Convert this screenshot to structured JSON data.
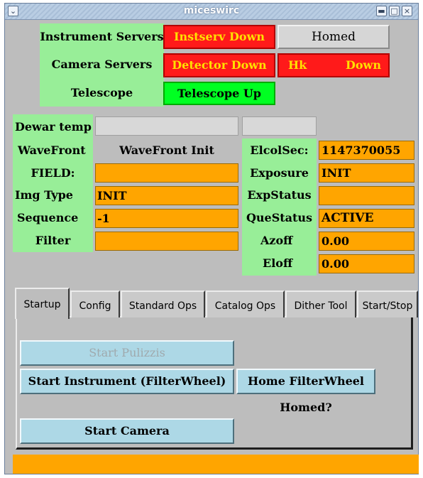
{
  "window": {
    "title": "miceswirc"
  },
  "servers": {
    "instrument_label": "Instrument Servers",
    "instrument_status": "Instserv Down",
    "homed_status": "Homed",
    "camera_label": "Camera Servers",
    "detector_status": "Detector Down",
    "hk_label": "Hk",
    "hk_status": "Down",
    "telescope_label": "Telescope",
    "telescope_status": "Telescope Up"
  },
  "status_left": {
    "dewar_label": "Dewar temp",
    "dewar_value": "",
    "dewar_value2": "",
    "wavefront_label": "WaveFront",
    "wavefront_value": "WaveFront Init",
    "field_label": "FIELD:",
    "field_value": "",
    "imgtype_label": "Img Type",
    "imgtype_value": "INIT",
    "sequence_label": "Sequence",
    "sequence_value": "-1",
    "filter_label": "Filter",
    "filter_value": ""
  },
  "status_right": {
    "elcolsec_label": "ElcolSec:",
    "elcolsec_value": "1147370055",
    "exposure_label": "Exposure",
    "exposure_value": "INIT",
    "expstatus_label": "ExpStatus",
    "expstatus_value": "",
    "questatus_label": "QueStatus",
    "questatus_value": "ACTIVE",
    "azoff_label": "Azoff",
    "azoff_value": "0.00",
    "eloff_label": "Eloff",
    "eloff_value": "0.00"
  },
  "tabs": [
    "Startup",
    "Config",
    "Standard Ops",
    "Catalog Ops",
    "Dither Tool",
    "Start/Stop"
  ],
  "startup": {
    "start_pulizzis": "Start Pulizzis",
    "start_instrument": "Start Instrument (FilterWheel)",
    "home_filterwheel": "Home  FilterWheel",
    "homed_question": "Homed?",
    "start_camera": "Start Camera"
  },
  "colors": {
    "panel_green": "#98ee98",
    "status_down_red": "#ff1a1a",
    "status_up_green": "#00ff22",
    "value_orange": "#ffa500",
    "button_blue": "#add8e6"
  }
}
